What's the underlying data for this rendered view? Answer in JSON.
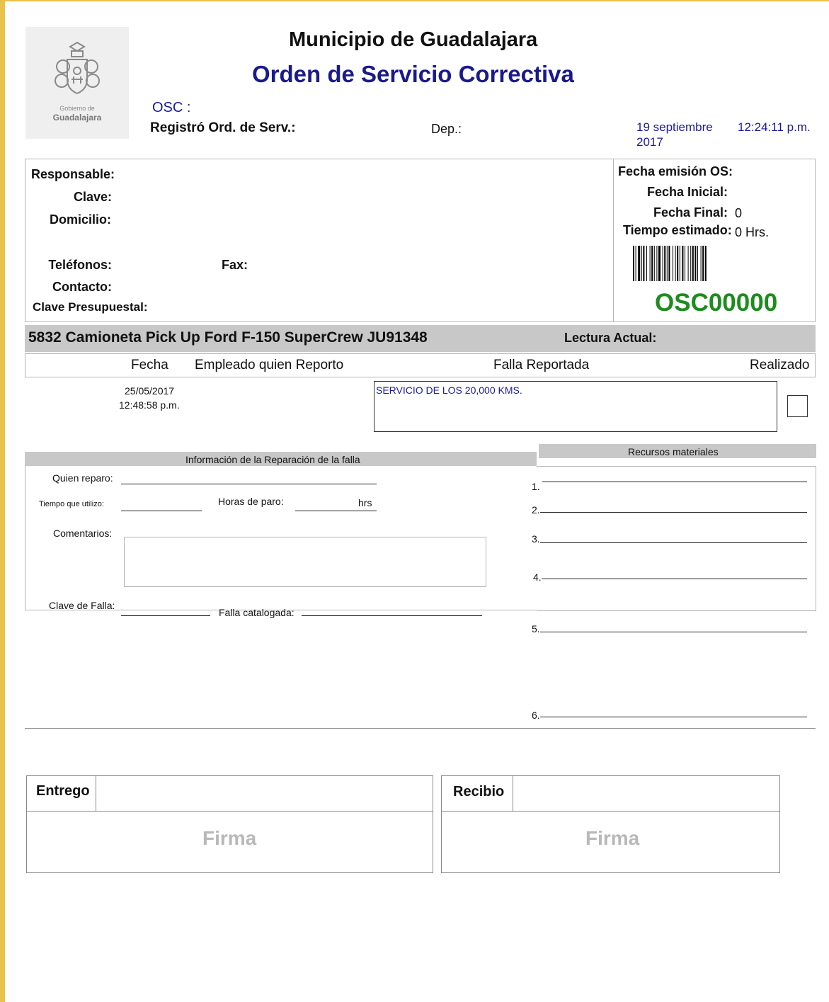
{
  "header": {
    "logo_caption_small": "Gobierno de",
    "logo_caption_big": "Guadalajara",
    "municipality": "Municipio de Guadalajara",
    "document_title": "Orden de Servicio Correctiva",
    "osc_label": "OSC :",
    "registered_label": "Registró Ord. de Serv.:",
    "dep_label": "Dep.:",
    "date_line1": "19 septiembre",
    "date_line2": "2017",
    "time": "12:24:11 p.m."
  },
  "responsible": {
    "responsable_label": "Responsable:",
    "clave_label": "Clave:",
    "domicilio_label": "Domicilio:",
    "telefonos_label": "Teléfonos:",
    "fax_label": "Fax:",
    "contacto_label": "Contacto:",
    "clave_presupuestal_label": "Clave Presupuestal:"
  },
  "dates_panel": {
    "fecha_emision_label": "Fecha emisión OS:",
    "fecha_inicial_label": "Fecha Inicial:",
    "fecha_final_label": "Fecha Final:",
    "fecha_final_value": "0",
    "tiempo_estimado_label": "Tiempo estimado:",
    "tiempo_estimado_value": "0 Hrs.",
    "order_code": "OSC00000",
    "order_code_color": "#1e8c1e"
  },
  "vehicle": {
    "description": "5832 Camioneta Pick Up  Ford  F-150 SuperCrew  JU91348",
    "lectura_label": "Lectura Actual:"
  },
  "fault_table": {
    "headers": {
      "fecha": "Fecha",
      "empleado": "Empleado quien Reporto",
      "falla": "Falla Reportada",
      "realizado": "Realizado"
    },
    "row": {
      "date": "25/05/2017",
      "time": "12:48:58 p.m.",
      "falla": "SERVICIO DE LOS 20,000 KMS.",
      "realizado_checked": false
    }
  },
  "repair_info": {
    "section_title": "Información de la Reparación de la falla",
    "quien_reparo_label": "Quien reparo:",
    "tiempo_label": "Tiempo que utilizo:",
    "horas_paro_label": "Horas de paro:",
    "hrs_unit": "hrs",
    "comentarios_label": "Comentarios:",
    "clave_falla_label": "Clave de Falla:",
    "falla_catalogada_label": "Falla catalogada:"
  },
  "materials": {
    "section_title": "Recursos materiales",
    "items": [
      "1.",
      "2.",
      "3.",
      "4.",
      "5.",
      "6."
    ]
  },
  "signatures": {
    "entrego_label": "Entrego",
    "recibio_label": "Recibio",
    "firma_label": "Firma"
  },
  "colors": {
    "title_blue": "#1a1a8c",
    "section_gray": "#c8c8c8",
    "frame_gold": "#e9c24a"
  }
}
